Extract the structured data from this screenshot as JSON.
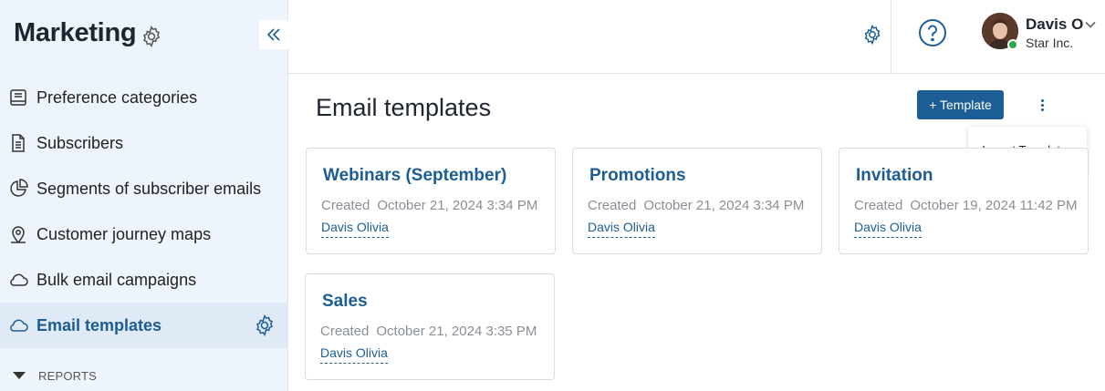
{
  "sidebar": {
    "title": "Marketing",
    "items": [
      {
        "label": "Preference categories",
        "icon": "book-icon"
      },
      {
        "label": "Subscribers",
        "icon": "document-icon"
      },
      {
        "label": "Segments of subscriber emails",
        "icon": "pie-chart-icon"
      },
      {
        "label": "Customer journey maps",
        "icon": "location-pin-icon"
      },
      {
        "label": "Bulk email campaigns",
        "icon": "cloud-icon"
      },
      {
        "label": "Email templates",
        "icon": "cloud-icon",
        "active": true
      }
    ],
    "reports_label": "REPORTS"
  },
  "header": {
    "user_name": "Davis O",
    "user_company": "Star Inc.",
    "status_color": "#2ba84a"
  },
  "main": {
    "title": "Email templates",
    "add_button_label": "+ Template",
    "menu": {
      "import_label": "Import Templates"
    },
    "cards": [
      {
        "title": "Webinars (September)",
        "created_label": "Created",
        "created": "October 21, 2024 3:34 PM",
        "author": "Davis Olivia"
      },
      {
        "title": "Promotions",
        "created_label": "Created",
        "created": "October 21, 2024 3:34 PM",
        "author": "Davis Olivia"
      },
      {
        "title": "Invitation",
        "created_label": "Created",
        "created": "October 19, 2024 11:42 PM",
        "author": "Davis Olivia"
      },
      {
        "title": "Sales",
        "created_label": "Created",
        "created": "October 21, 2024 3:35 PM",
        "author": "Davis Olivia"
      }
    ]
  },
  "colors": {
    "accent": "#1d5d95",
    "sidebar_bg": "#eef4fb",
    "sidebar_active_bg": "#dfeaf6"
  }
}
